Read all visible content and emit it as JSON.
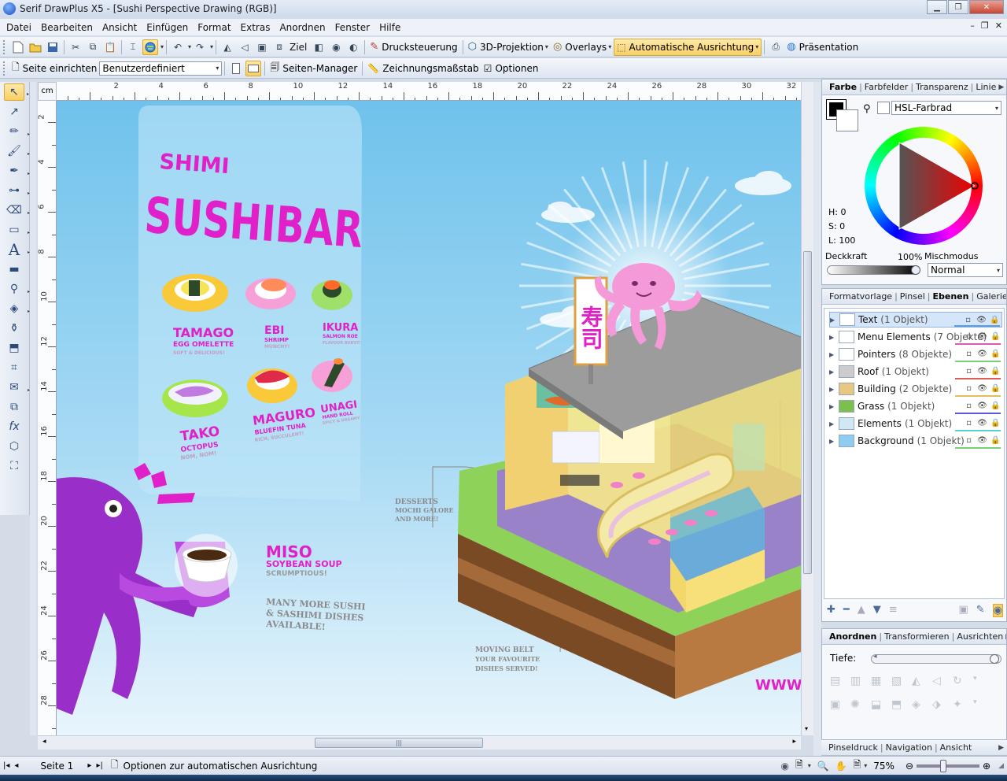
{
  "window": {
    "title": "Serif DrawPlus X5 - [Sushi Perspective Drawing (RGB)]"
  },
  "menu": [
    "Datei",
    "Bearbeiten",
    "Ansicht",
    "Einfügen",
    "Format",
    "Extras",
    "Anordnen",
    "Fenster",
    "Hilfe"
  ],
  "toolbar1": {
    "ziel": "Ziel",
    "drucksteuerung": "Drucksteuerung",
    "projektion": "3D-Projektion",
    "overlays": "Overlays",
    "auto_ausrichtung": "Automatische Ausrichtung",
    "praesentation": "Präsentation"
  },
  "toolbar2": {
    "seite_einrichten": "Seite einrichten",
    "page_size": "Benutzerdefiniert",
    "seiten_manager": "Seiten-Manager",
    "zeichnungsmassstab": "Zeichnungsmaßstab",
    "optionen": "Optionen"
  },
  "ruler": {
    "unit": "cm",
    "h_labels": [
      "2",
      "4",
      "6",
      "8",
      "10",
      "12",
      "14",
      "16",
      "18",
      "20",
      "22",
      "24",
      "26",
      "28",
      "30",
      "32"
    ],
    "v_labels": [
      "2",
      "4",
      "6",
      "8",
      "10",
      "12",
      "14",
      "16",
      "18",
      "20",
      "22",
      "24",
      "26",
      "28"
    ]
  },
  "artwork": {
    "shimi": "SHIMI",
    "sushibar": "SUSHIBAR",
    "menu_items": [
      {
        "name": "TAMAGO",
        "sub": "EGG OMELETTE",
        "desc": "SOFT & DELICIOUS!"
      },
      {
        "name": "EBI",
        "sub": "SHRIMP",
        "desc": "MUNCHY!"
      },
      {
        "name": "IKURA",
        "sub": "SALMON ROE",
        "desc": "FLAVOUR BURST!"
      },
      {
        "name": "TAKO",
        "sub": "OCTOPUS",
        "desc": "NOM, NOM!"
      },
      {
        "name": "MAGURO",
        "sub": "BLUEFIN TUNA",
        "desc": "RICH, SUCCULENT!"
      },
      {
        "name": "UNAGI",
        "sub": "HAND ROLL",
        "desc": "SPICY & DREAMY"
      }
    ],
    "miso": "MISO",
    "miso_sub": "SOYBEAN SOUP",
    "miso_desc": "SCRUMPTIOUS!",
    "more": [
      "MANY MORE SUSHI",
      "& SASHIMI DISHES",
      "AVAILABLE!"
    ],
    "desserts": [
      "DESSERTS",
      "MOCHI GALORE",
      "AND MORE!"
    ],
    "moving": [
      "MOVING BELT",
      "YOUR FAVOURITE",
      "DISHES SERVED!"
    ],
    "sign": "寿司",
    "www": "WWW"
  },
  "color_panel": {
    "tabs": [
      "Farbe",
      "Farbfelder",
      "Transparenz",
      "Linie"
    ],
    "mode": "HSL-Farbrad",
    "h": "H: 0",
    "s": "S: 0",
    "l": "L: 100",
    "opacity_label": "Deckkraft",
    "opacity_value": "100%",
    "blend_label": "Mischmodus",
    "blend_value": "Normal"
  },
  "layers_panel": {
    "tabs": [
      "Formatvorlage",
      "Pinsel",
      "Ebenen",
      "Galerie"
    ],
    "layers": [
      {
        "name": "Text",
        "count": "(1 Objekt)",
        "color": "#5aa0e0"
      },
      {
        "name": "Menu Elements",
        "count": "(7 Objekte)",
        "color": "#e05ab4"
      },
      {
        "name": "Pointers",
        "count": "(8 Objekte)",
        "color": "#7ad07a"
      },
      {
        "name": "Roof",
        "count": "(1 Objekt)",
        "color": "#e05a5a"
      },
      {
        "name": "Building",
        "count": "(2 Objekte)",
        "color": "#e0c05a"
      },
      {
        "name": "Grass",
        "count": "(1 Objekt)",
        "color": "#5a5ae0"
      },
      {
        "name": "Elements",
        "count": "(1 Objekt)",
        "color": "#5ad0d0"
      },
      {
        "name": "Background",
        "count": "(1 Objekt)",
        "color": "#7ad07a"
      }
    ]
  },
  "arrange_panel": {
    "tabs": [
      "Anordnen",
      "Transformieren",
      "Ausrichten"
    ],
    "depth_label": "Tiefe:"
  },
  "bottom_tabs": [
    "Pinseldruck",
    "Navigation",
    "Ansicht"
  ],
  "status": {
    "page": "Seite 1",
    "hint": "Optionen zur automatischen Ausrichtung",
    "zoom": "75%"
  },
  "colors": {
    "accent": "#f8cf64",
    "magenta": "#e020c8",
    "sky": "#6fc2ec"
  }
}
